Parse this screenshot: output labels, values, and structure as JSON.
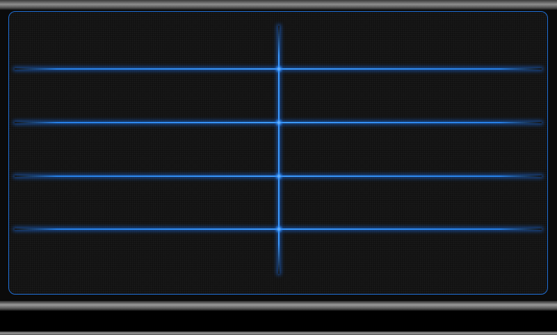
{
  "colors": {
    "accent": "#3d9bff",
    "border": "#1f6fd6",
    "background": "#111111"
  },
  "grid": {
    "horizontal_lines": 4,
    "vertical_lines": 1
  }
}
